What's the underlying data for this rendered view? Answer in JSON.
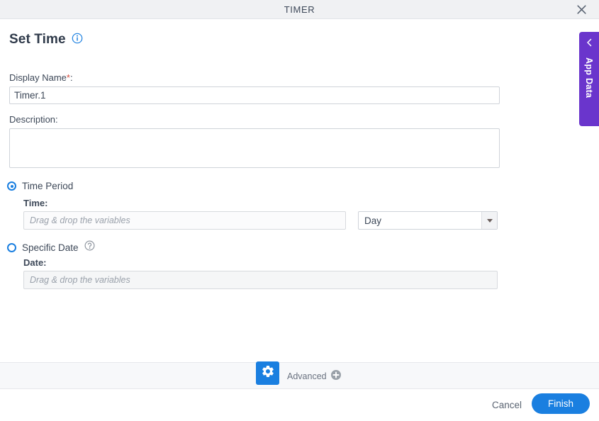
{
  "window": {
    "title": "TIMER",
    "close_icon": "close-icon"
  },
  "heading": {
    "title": "Set Time",
    "info_icon": "info-icon"
  },
  "fields": {
    "display_name": {
      "label": "Display Name",
      "required_marker": "*",
      "colon": ":",
      "value": "Timer.1",
      "placeholder": ""
    },
    "description": {
      "label": "Description:",
      "value": "",
      "placeholder": ""
    }
  },
  "options": {
    "time_period": {
      "label": "Time Period",
      "selected": true,
      "time_label": "Time:",
      "time_value": "",
      "time_placeholder": "Drag & drop the variables",
      "unit": {
        "selected": "Day",
        "arrow_icon": "chevron-down-icon"
      }
    },
    "specific_date": {
      "label": "Specific Date",
      "selected": false,
      "help_icon": "question-circle-icon",
      "date_label": "Date:",
      "date_value": "",
      "date_placeholder": "Drag & drop the variables"
    }
  },
  "advanced": {
    "gear_icon": "gear-icon",
    "label": "Advanced",
    "plus_icon": "plus-circle-icon"
  },
  "footer": {
    "cancel_label": "Cancel",
    "finish_label": "Finish"
  },
  "side_panel": {
    "label": "App Data",
    "collapse_icon": "chevron-left-icon"
  },
  "colors": {
    "accent_blue": "#1a7fe0",
    "panel_purple": "#6a35cc",
    "required_red": "#d64c3d",
    "text_dark": "#3d4858"
  }
}
